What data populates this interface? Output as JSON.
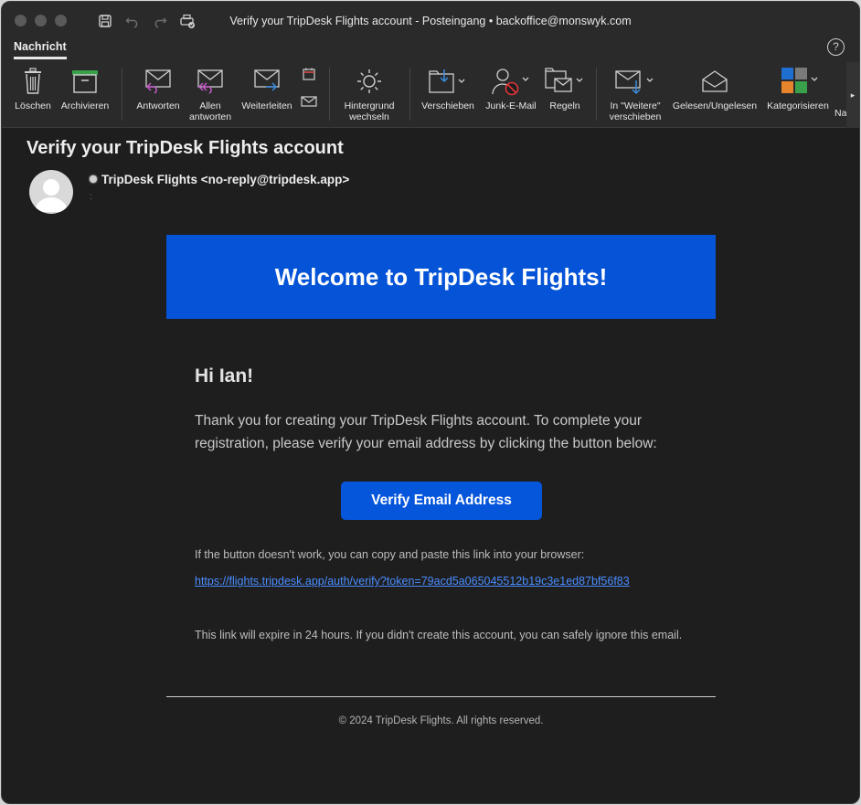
{
  "window": {
    "title": "Verify your TripDesk Flights account - Posteingang • backoffice@monswyk.com"
  },
  "tabs": {
    "active": "Nachricht"
  },
  "ribbon": {
    "items": [
      {
        "label": "Löschen",
        "icon": "trash-icon"
      },
      {
        "label": "Archivieren",
        "icon": "archive-icon"
      },
      {
        "label": "Antworten",
        "icon": "reply-icon"
      },
      {
        "label": "Allen antworten",
        "icon": "reply-all-icon"
      },
      {
        "label": "Weiterleiten",
        "icon": "forward-icon"
      },
      {
        "label": "Hintergrund wechseln",
        "icon": "sun-icon"
      },
      {
        "label": "Verschieben",
        "icon": "move-icon"
      },
      {
        "label": "Junk-E-Mail",
        "icon": "junk-icon"
      },
      {
        "label": "Regeln",
        "icon": "rules-icon"
      },
      {
        "label": "In \"Weitere\" verschieben",
        "icon": "move-to-other-icon"
      },
      {
        "label": "Gelesen/Ungelesen",
        "icon": "read-unread-icon"
      },
      {
        "label": "Kategorisieren",
        "icon": "categorize-icon"
      }
    ],
    "overflow_label": "Na",
    "more_glyph": "▸"
  },
  "message": {
    "subject": "Verify your TripDesk Flights account",
    "sender": "TripDesk Flights <no-reply@tripdesk.app>"
  },
  "email": {
    "banner_title": "Welcome to TripDesk Flights!",
    "greeting": "Hi Ian!",
    "intro": "Thank you for creating your TripDesk Flights account. To complete your registration, please verify your email address by clicking the button below:",
    "button_label": "Verify Email Address",
    "fallback_text": "If the button doesn't work, you can copy and paste this link into your browser:",
    "link": "https://flights.tripdesk.app/auth/verify?token=79acd5a065045512b19c3e1ed87bf56f83",
    "expire_text": "This link will expire in 24 hours. If you didn't create this account, you can safely ignore this email.",
    "footer": "© 2024 TripDesk Flights. All rights reserved."
  },
  "colors": {
    "banner": "#0553d6",
    "button": "#0656dc",
    "link": "#4a8cff",
    "background": "#1e1e1e"
  }
}
